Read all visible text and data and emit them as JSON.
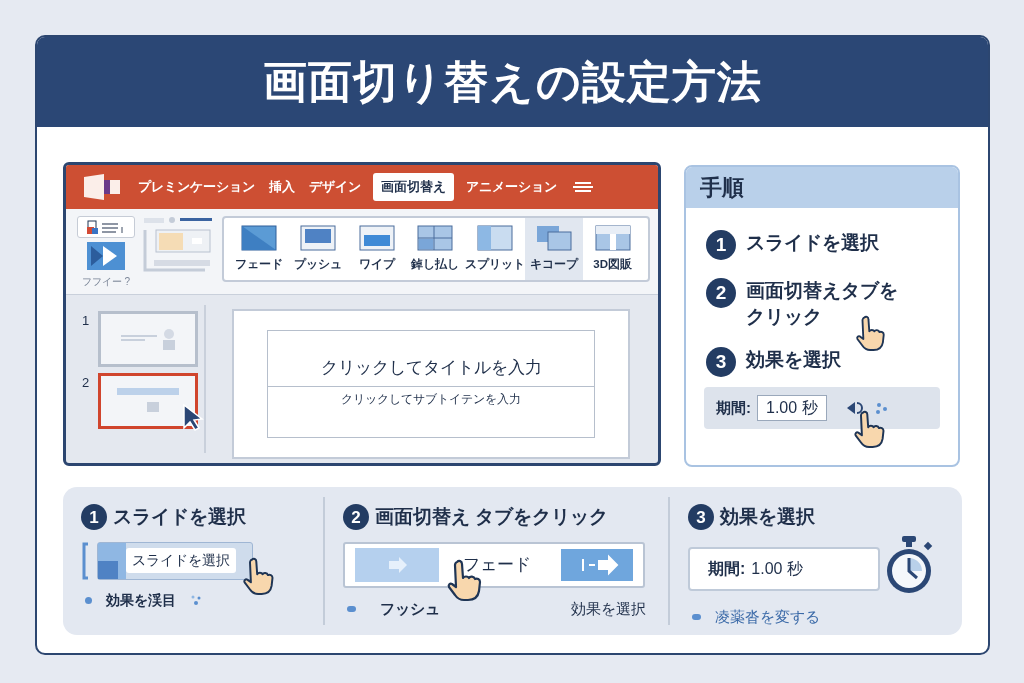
{
  "title": "画面切り替えの設定方法",
  "app": {
    "tabs": [
      {
        "label": "プレミンケーション",
        "selected": false
      },
      {
        "label": "挿入",
        "selected": false
      },
      {
        "label": "デザイン",
        "selected": false
      },
      {
        "label": "画面切替え",
        "selected": true
      },
      {
        "label": "アニメーション",
        "selected": false
      }
    ],
    "ribbon_label": "フフイー ?",
    "effects": [
      {
        "label": "フェード",
        "selected": false
      },
      {
        "label": "プッシュ",
        "selected": false
      },
      {
        "label": "ワイプ",
        "selected": false
      },
      {
        "label": "鋽し払し",
        "selected": false
      },
      {
        "label": "スプリット",
        "selected": false
      },
      {
        "label": "キコープ",
        "selected": true
      },
      {
        "label": "3D図販",
        "selected": false
      }
    ],
    "slides": [
      {
        "number": "1",
        "selected": false
      },
      {
        "number": "2",
        "selected": true
      }
    ],
    "slide_title": "クリックしてタイトルを入力",
    "slide_subtitle": "クリックしてサブトイテンを入力"
  },
  "steps_panel": {
    "heading": "手順",
    "steps": [
      {
        "number": "1",
        "text": "スライドを選択"
      },
      {
        "number": "2",
        "text": "画面切替えタブをクリック"
      },
      {
        "number": "3",
        "text": "効果を選択"
      }
    ],
    "duration_label": "期間:",
    "duration_value": "1.00 秒"
  },
  "bottom_steps": [
    {
      "kind": "slide",
      "number": "1",
      "heading": "スライドを選択",
      "button": "スライドを選択",
      "note": "効果を渓目"
    },
    {
      "kind": "effect",
      "number": "2",
      "heading": "画面切替え タブをクリック",
      "effect": "フェード",
      "note_left": "フッシュ",
      "note_right": "効果を選択"
    },
    {
      "kind": "duration",
      "number": "3",
      "heading": "効果を選択",
      "label": "期間:",
      "value": "1.00 秒",
      "note": "凌薬沓を変する"
    }
  ]
}
